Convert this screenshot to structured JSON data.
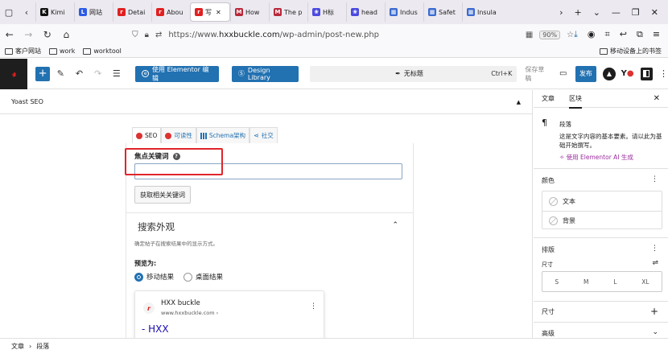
{
  "browser": {
    "tabs": [
      {
        "label": "Kimi",
        "fav_color": "#111111",
        "fav_glyph": "K"
      },
      {
        "label": "网站",
        "fav_color": "#2b5ce6",
        "fav_glyph": "L"
      },
      {
        "label": "Detai",
        "fav_color": "#e02020",
        "fav_glyph": "r"
      },
      {
        "label": "Abou",
        "fav_color": "#e02020",
        "fav_glyph": "r"
      },
      {
        "label": "写",
        "fav_color": "#e02020",
        "fav_glyph": "r",
        "active": true
      },
      {
        "label": "How",
        "fav_color": "#b8283a",
        "fav_glyph": "M"
      },
      {
        "label": "The p",
        "fav_color": "#b8283a",
        "fav_glyph": "M"
      },
      {
        "label": "H标",
        "fav_color": "#4a4ae0",
        "fav_glyph": "❀"
      },
      {
        "label": "head",
        "fav_color": "#4a4ae0",
        "fav_glyph": "❀"
      },
      {
        "label": "Indus",
        "fav_color": "#3a6ad0",
        "fav_glyph": "▦"
      },
      {
        "label": "Safet",
        "fav_color": "#3a6ad0",
        "fav_glyph": "▦"
      },
      {
        "label": "Insula",
        "fav_color": "#3a6ad0",
        "fav_glyph": "▦"
      }
    ],
    "url_prefix": "https://www.",
    "url_host": "hxxbuckle.com",
    "url_path": "/wp-admin/post-new.php",
    "zoom": "90%",
    "bookmarks": [
      "客户网站",
      "work",
      "worktool"
    ],
    "mobile_bookmarks": "移动设备上的书签"
  },
  "toolbar": {
    "elementor_label": "使用 Elementor 编辑",
    "design_library_label": "Design Library",
    "doc_title": "无标题",
    "shortcut": "Ctrl+K",
    "save_draft": "保存草稿",
    "publish": "发布"
  },
  "yoast": {
    "header": "Yoast SEO",
    "tabs": [
      "SEO",
      "可读性",
      "Schema架构",
      "社交"
    ],
    "focus_keyword_label": "焦点关键词",
    "focus_keyword_value": "",
    "related_button": "获取相关关键词",
    "search_appearance_title": "搜索外观",
    "search_appearance_desc": "确定帖子在搜索结果中的显示方式。",
    "preview_label": "预览为:",
    "preview_options": [
      "移动结果",
      "桌面结果"
    ],
    "selected_preview": "移动结果",
    "serp": {
      "site_name": "HXX buckle",
      "url": "www.hxxbuckle.com ›",
      "title": "- HXX"
    }
  },
  "sidebar": {
    "tabs": [
      "文章",
      "区块"
    ],
    "active_tab": "区块",
    "block_name": "段落",
    "block_desc": "这是文字内容的基本要素。请以此为基础开始撰写。",
    "ai_link": "使用 Elementor AI 生成",
    "color_title": "颜色",
    "color_items": [
      "文本",
      "背景"
    ],
    "typography_title": "排版",
    "size_label": "尺寸",
    "size_options": [
      "S",
      "M",
      "L",
      "XL"
    ],
    "dimensions_title": "尺寸",
    "advanced_title": "高级"
  },
  "footer": {
    "breadcrumb": [
      "文章",
      "段落"
    ]
  },
  "colors": {
    "accent": "#2271b1",
    "highlight_box": "#e0252b",
    "brand_red": "#e02020"
  }
}
